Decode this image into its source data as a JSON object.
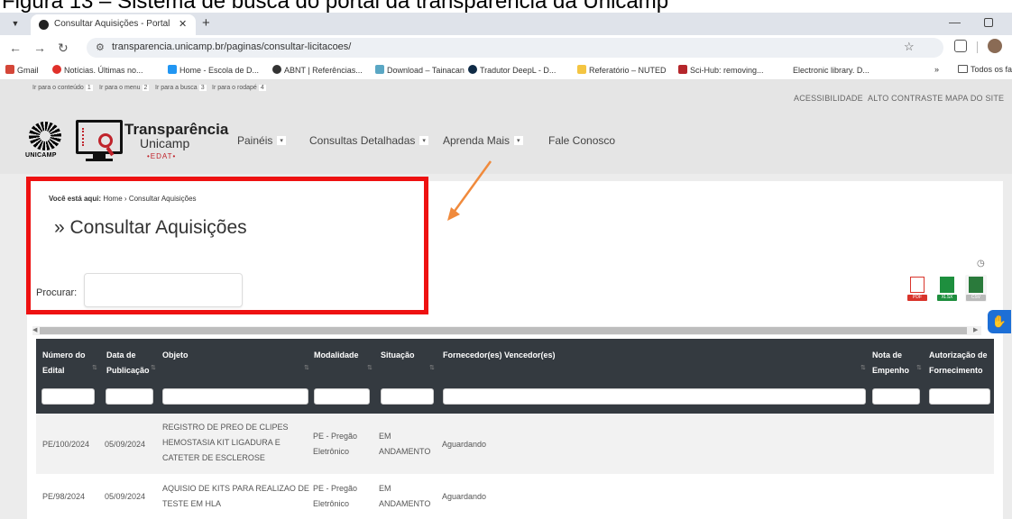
{
  "caption": "Figura 13 – Sistema de busca do portal da transparência da Unicamp",
  "browser": {
    "tab_title": "Consultar Aquisições - Portal Tr",
    "tab_close": "✕",
    "new_tab": "+",
    "url": "transparencia.unicamp.br/paginas/consultar-licitacoes/",
    "bookmarks": [
      "Gmail",
      "Notícias. Últimas no...",
      "Home - Escola de D...",
      "ABNT | Referências...",
      "Download – Tainacan",
      "Tradutor DeepL - D...",
      "Referatório – NUTED",
      "Sci-Hub: removing...",
      "Electronic library. D...",
      "»",
      "Todos os favoritos"
    ]
  },
  "accessibility": [
    {
      "label": "Ir para o conteúdo",
      "key": "1"
    },
    {
      "label": "Ir para o menu",
      "key": "2"
    },
    {
      "label": "Ir para a busca",
      "key": "3"
    },
    {
      "label": "Ir para o rodapé",
      "key": "4"
    }
  ],
  "top_links": [
    "ACESSIBILIDADE",
    "ALTO CONTRASTE",
    "MAPA DO SITE"
  ],
  "brand": {
    "logo_text": "UNICAMP",
    "name": "Transparência",
    "sub": "Unicamp",
    "edat": "•EDAT•"
  },
  "menu": [
    "Painéis",
    "Consultas Detalhadas",
    "Aprenda Mais",
    "Fale Conosco"
  ],
  "breadcrumb": {
    "prefix": "Você está aqui:",
    "home": "Home",
    "sep": "›",
    "current": "Consultar Aquisições"
  },
  "page_title": "» Consultar Aquisições",
  "search": {
    "label": "Procurar:",
    "value": ""
  },
  "downloads": [
    {
      "label": "PDF",
      "color": "#d9342b"
    },
    {
      "label": "XLSX",
      "color": "#1e8f3e"
    },
    {
      "label": "CSV",
      "color": "#2a7a3b"
    }
  ],
  "table": {
    "headers": [
      "Número do Edital",
      "Data de Publicação",
      "Objeto",
      "Modalidade",
      "Situação",
      "Fornecedor(es) Vencedor(es)",
      "Nota de Empenho",
      "Autorização de Fornecimento"
    ],
    "rows": [
      {
        "edital": "PE/100/2024",
        "data": "05/09/2024",
        "objeto": "REGISTRO DE PREO DE CLIPES HEMOSTASIA KIT LIGADURA E CATETER DE ESCLEROSE",
        "modalidade": "PE - Pregão Eletrônico",
        "situacao": "EM ANDAMENTO",
        "fornecedor": "Aguardando"
      },
      {
        "edital": "PE/98/2024",
        "data": "05/09/2024",
        "objeto": "AQUISIO DE KITS PARA REALIZAO DE TESTE EM HLA",
        "modalidade": "PE - Pregão Eletrônico",
        "situacao": "EM ANDAMENTO",
        "fornecedor": "Aguardando"
      }
    ]
  }
}
